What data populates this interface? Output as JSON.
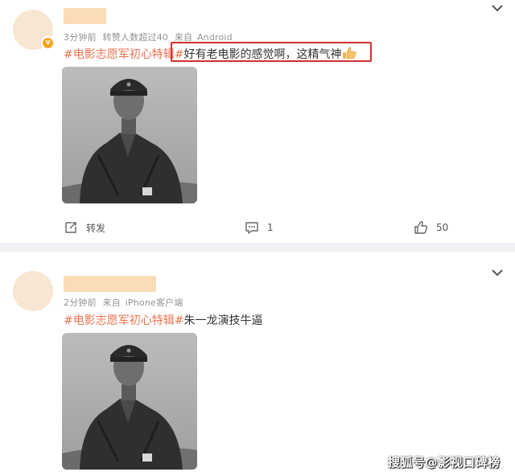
{
  "posts": [
    {
      "time_label": "3分钟前",
      "likes_label": "转赞人数超过40",
      "source_prefix": "来自",
      "source": "Android",
      "hashtag": "#电影志愿军初心特辑#",
      "text": "好有老电影的感觉啊，这精气神",
      "actions": {
        "repost_label": "转发",
        "comment_count": "1",
        "like_count": "50"
      }
    },
    {
      "time_label": "2分钟前",
      "source_prefix": "来自",
      "source": "iPhone客户端",
      "hashtag": "#电影志愿军初心特辑#",
      "text": "朱一龙演技牛逼"
    }
  ],
  "watermark": "搜狐号@影视口碑榜",
  "colors": {
    "hashtag": "#eb7350",
    "highlight_border": "#d32f2f",
    "name_mask": "#fbdcb9",
    "meta": "#939393",
    "separator": "#eef0f3"
  },
  "icons": [
    "chevron-down-icon",
    "verified-badge-icon",
    "repost-icon",
    "comment-icon",
    "like-icon",
    "thumbs-up-emoji"
  ]
}
